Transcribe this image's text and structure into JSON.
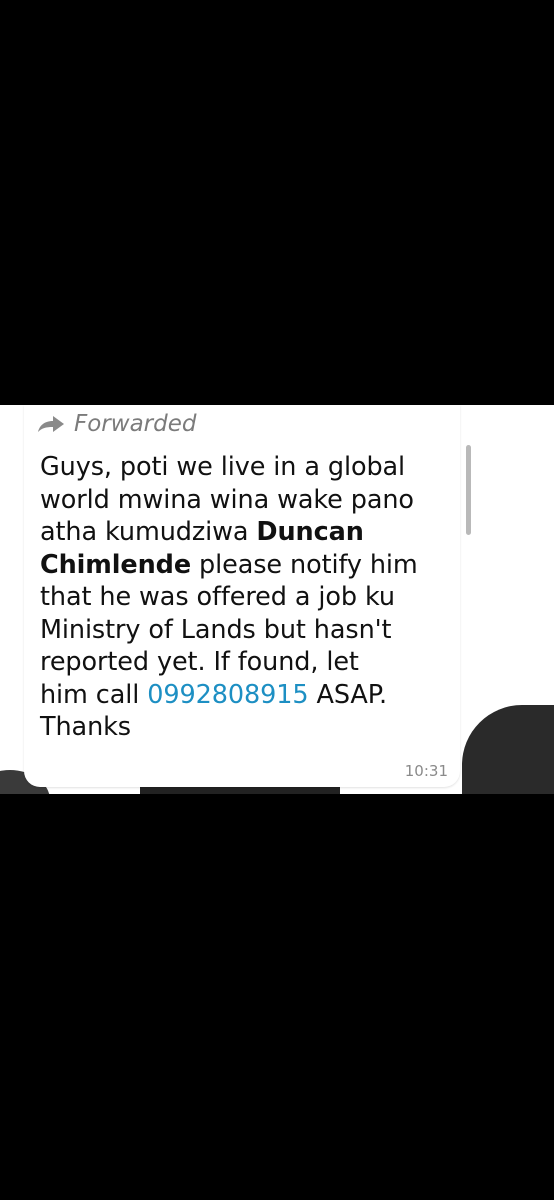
{
  "message": {
    "forwarded_label": "Forwarded",
    "line1": "Guys, poti we live in a global",
    "line2": "world mwina wina wake pano",
    "line3_prefix": "atha kumudziwa ",
    "line3_bold": "Duncan",
    "line4_bold": "Chimlende",
    "line4_suffix": " please notify him",
    "line5": "that he was offered a job ku",
    "line6": "Ministry of Lands but hasn't",
    "line7": "reported yet. If found, let",
    "line8_prefix": "him call ",
    "line8_phone": "0992808915",
    "line8_suffix": " ASAP.",
    "line9": "Thanks",
    "time": "10:31"
  },
  "colors": {
    "background": "#000000",
    "bubble": "#ffffff",
    "text": "#111111",
    "meta_text": "#7b7b7b",
    "link": "#1d8fc3"
  },
  "icons": {
    "forwarded": "forward-arrow-icon"
  }
}
